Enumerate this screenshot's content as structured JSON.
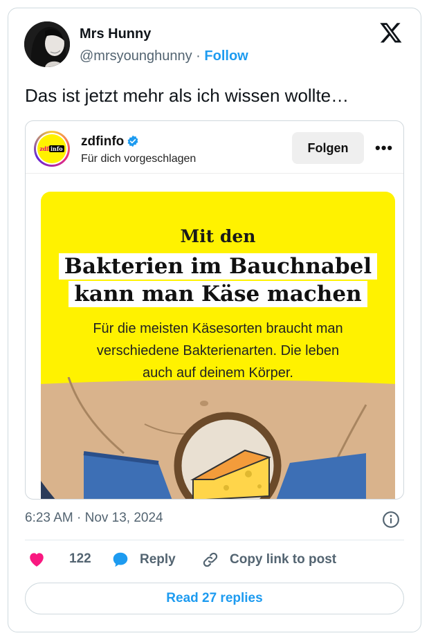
{
  "tweet": {
    "author_name": "Mrs Hunny",
    "author_handle": "@mrsyounghunny",
    "separator": "·",
    "follow_label": "Follow",
    "text": "Das ist jetzt mehr als ich wissen wollte…",
    "timestamp": "6:23 AM · Nov 13, 2024",
    "like_count": "122",
    "reply_label": "Reply",
    "copy_label": "Copy link to post",
    "read_replies_label": "Read 27 replies"
  },
  "embed": {
    "account_name": "zdfinfo",
    "subtitle": "Für dich vorgeschlagen",
    "follow_label": "Folgen",
    "more_label": "•••",
    "logo_text_a": "zdf",
    "logo_text_b": "info",
    "image": {
      "line1": "Mit den",
      "headline_1": "Bakterien im Bauchnabel",
      "headline_2": "kann man Käse machen",
      "desc_1": "Für die meisten Käsesorten braucht man",
      "desc_2": "verschiedene Bakterienarten. Die leben",
      "desc_3": "auch auf deinem Körper."
    }
  },
  "colors": {
    "accent": "#1d9bf0",
    "like": "#f91880",
    "image_bg": "#fff200",
    "skin": "#d9b38c"
  }
}
